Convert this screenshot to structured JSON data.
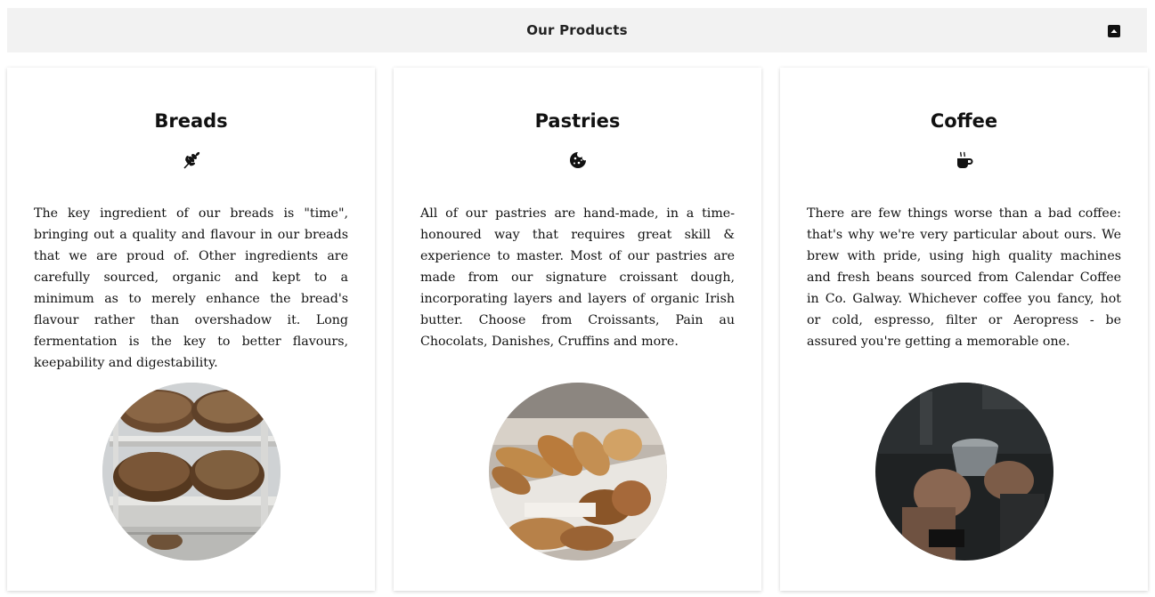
{
  "header": {
    "title": "Our Products"
  },
  "products": [
    {
      "title": "Breads",
      "icon": "wheat-icon",
      "description": "The key ingredient of our breads is \"time\", bringing out a quality and flavour in our breads that we are proud of. Other ingredients are carefully sourced, organic and kept to a minimum as to merely enhance the bread's flavour rather than overshadow it. Long fermentation is the key to better flavours, keepability and digestability."
    },
    {
      "title": "Pastries",
      "icon": "cookie-icon",
      "description": "All of our pastries are hand-made, in a time-honoured way that requires great skill & experience to master. Most of our pastries are made from our signature croissant dough, incorporating layers and layers of organic Irish butter. Choose from Croissants, Pain au Chocolats, Danishes, Cruffins and more."
    },
    {
      "title": "Coffee",
      "icon": "coffee-cup-icon",
      "description": "There are few things worse than a bad coffee: that's why we're very particular about ours. We brew with pride, using high quality machines and fresh beans sourced from Calendar Coffee in Co. Galway. Whichever coffee you fancy, hot or cold, espresso, filter or Aeropress - be assured you're getting a memorable one."
    }
  ],
  "colors": {
    "header_bg": "#f2f2f2",
    "text": "#111111"
  }
}
